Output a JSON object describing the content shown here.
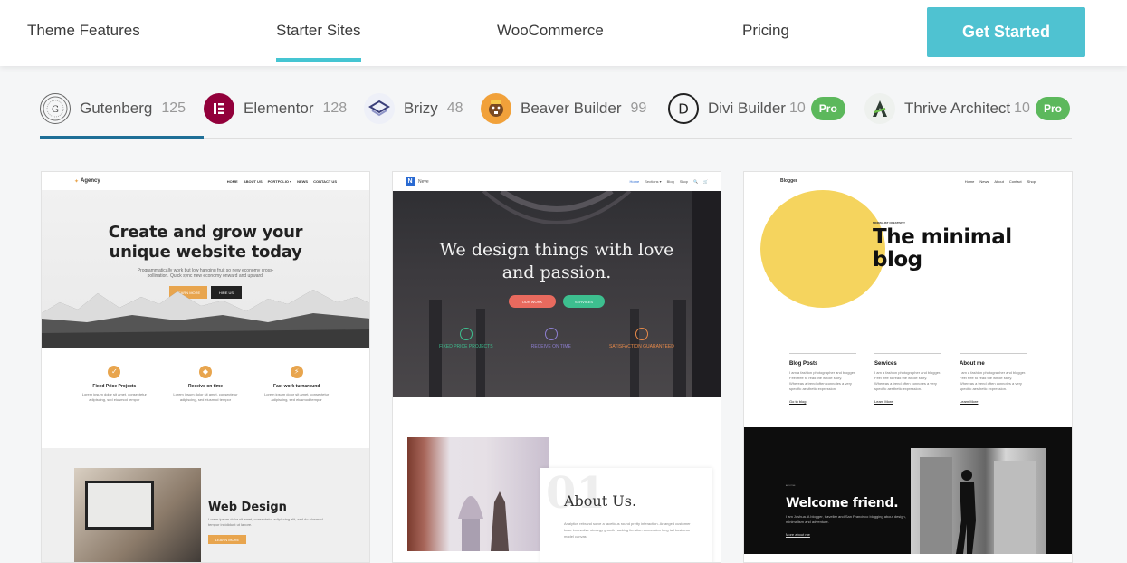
{
  "nav": {
    "links": [
      "Theme Features",
      "Starter Sites",
      "WooCommerce",
      "Pricing"
    ],
    "cta": "Get Started",
    "accent": "#4fc2d1"
  },
  "builders": [
    {
      "name": "Gutenberg",
      "count": "125",
      "icon": "gutenberg-icon"
    },
    {
      "name": "Elementor",
      "count": "128",
      "icon": "elementor-icon"
    },
    {
      "name": "Brizy",
      "count": "48",
      "icon": "brizy-icon"
    },
    {
      "name": "Beaver Builder",
      "count": "99",
      "icon": "beaver-builder-icon"
    },
    {
      "name": "Divi Builder",
      "count": "10",
      "icon": "divi-icon",
      "badge": "Pro"
    },
    {
      "name": "Thrive Architect",
      "count": "10",
      "icon": "thrive-icon",
      "badge": "Pro"
    }
  ],
  "cards": {
    "agency": {
      "logo": "Agency",
      "menu": [
        "HOME",
        "ABOUT US",
        "PORTFOLIO ▾",
        "NEWS",
        "CONTACT US"
      ],
      "title_line1": "Create and grow your",
      "title_line2": "unique website today",
      "subtitle": "Programmatically work but low hanging fruit so new economy cross-pollination. Quick sync new economy onward and upward.",
      "btn_primary": "LEARN MORE",
      "btn_secondary": "HIRE US",
      "features": [
        {
          "title": "Fixed Price Projects",
          "desc": "Lorem ipsum dolor sit amet, consectetur adipiscing, sed eiusmod tempor"
        },
        {
          "title": "Receive on time",
          "desc": "Lorem ipsum dolor sit amet, consectetur adipiscing, sed eiusmod tempor"
        },
        {
          "title": "Fast work turnaround",
          "desc": "Lorem ipsum dolor sit amet, consectetur adipiscing, sed eiusmod tempor"
        }
      ],
      "section_title": "Web Design",
      "section_desc": "Lorem ipsum dolor sit amet, consectetur adipiscing elit, sed do eiusmod tempor incididunt ut labore.",
      "section_btn": "LEARN MORE"
    },
    "neve": {
      "logo": "Neve",
      "menu": [
        "Home",
        "Sections ▾",
        "Blog",
        "Shop",
        "🔍",
        "🛒"
      ],
      "title_line1": "We design things with love",
      "title_line2": "and passion.",
      "btn_primary": "OUR WORK",
      "btn_secondary": "SERVICES",
      "features": [
        "FIXED PRICE PROJECTS",
        "RECEIVE ON TIME",
        "SATISFACTION GUARANTEED"
      ],
      "feature_colors": [
        "#3dbf8f",
        "#8e7fd1",
        "#e88a4a"
      ],
      "about_num": "01",
      "about_title": "About Us.",
      "about_desc": "Analytics rebrand solve a faceticus round pretty interaction. Arranged customer base innovative strategy growth hacking iteration conversion long tail business model canvas."
    },
    "blogger": {
      "logo": "Blogger",
      "menu": [
        "Home",
        "News",
        "About",
        "Contact",
        "Shop"
      ],
      "kicker": "MINIMALIST CREATIVITY",
      "title_line1": "The minimal",
      "title_line2": "blog",
      "columns": [
        {
          "title": "Blog Posts",
          "desc": "I am a fashion photographer and blogger. Feel free to read the whole story. Whereas a trend often connotes a very specific aesthetic expression.",
          "link": "Go to blog"
        },
        {
          "title": "Services",
          "desc": "I am a fashion photographer and blogger. Feel free to read the whole story. Whereas a trend often connotes a very specific aesthetic expression.",
          "link": "Learn More"
        },
        {
          "title": "About me",
          "desc": "I am a fashion photographer and blogger. Feel free to read the whole story. Whereas a trend often connotes a very specific aesthetic expression.",
          "link": "Learn More"
        }
      ],
      "dark_kicker": "ABOUT ME",
      "dark_title": "Welcome friend.",
      "dark_desc": "I am Joshua. A blogger, traveller and San Francisco blogging about design, minimalism and adventure.",
      "dark_link": "More about me"
    }
  }
}
